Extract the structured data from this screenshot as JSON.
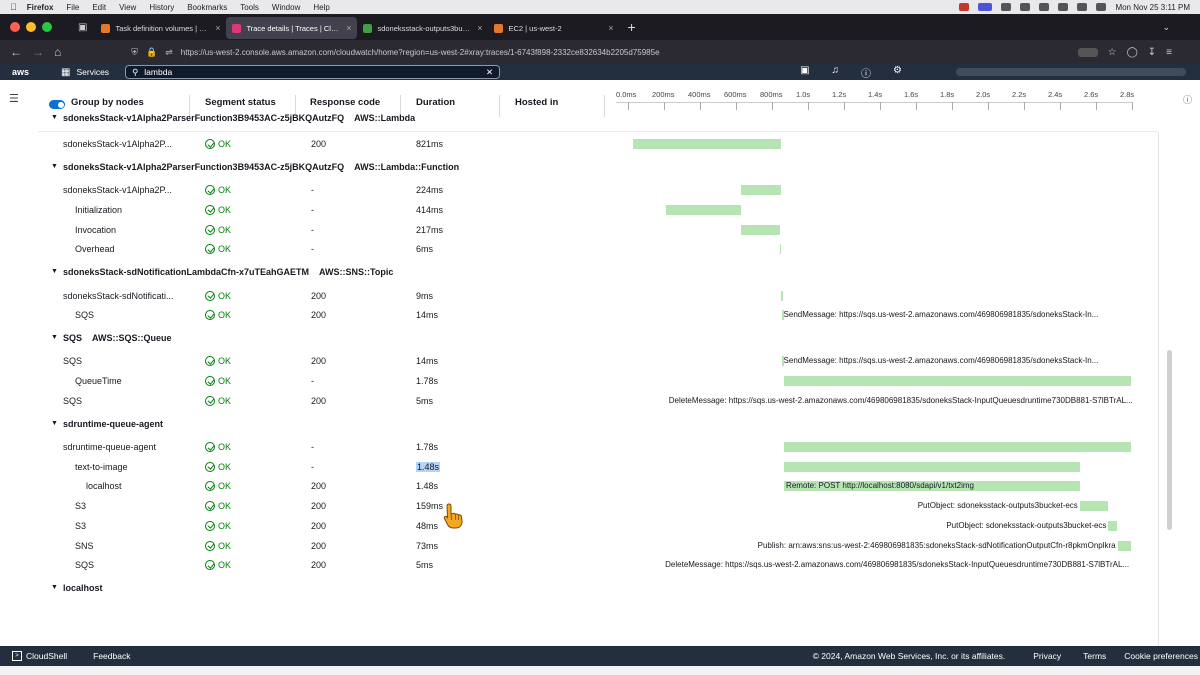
{
  "mac_menu": {
    "app": "Firefox",
    "items": [
      "File",
      "Edit",
      "View",
      "History",
      "Bookmarks",
      "Tools",
      "Window",
      "Help"
    ],
    "clock": "Mon Nov 25  3:11 PM"
  },
  "browser": {
    "tabs": [
      {
        "label": "Task definition volumes | Elastic",
        "color": "#e8772e"
      },
      {
        "label": "Trace details | Traces | CloudWa",
        "color": "#e0357a",
        "active": true
      },
      {
        "label": "sdoneksstack-outputs3bucket-",
        "color": "#3fa142"
      },
      {
        "label": "EC2 | us-west-2",
        "color": "#e8772e"
      }
    ],
    "url": "https://us-west-2.console.aws.amazon.com/cloudwatch/home?region=us-west-2#xray:traces/1-6743f898-2332ce832634b2205d75985e"
  },
  "aws_header": {
    "logo": "aws",
    "services_label": "Services",
    "search_value": "lambda"
  },
  "columns": {
    "group_by_nodes": "Group by nodes",
    "segment_status": "Segment status",
    "response_code": "Response code",
    "duration": "Duration",
    "hosted_in": "Hosted in"
  },
  "timeline_ticks": [
    "0.0ms",
    "200ms",
    "400ms",
    "600ms",
    "800ms",
    "1.0s",
    "1.2s",
    "1.4s",
    "1.6s",
    "1.8s",
    "2.0s",
    "2.2s",
    "2.4s",
    "2.6s",
    "2.8s"
  ],
  "rows": [
    {
      "kind": "group",
      "name": "sdoneksStack-v1Alpha2ParserFunction3B9453AC-z5jBKQAutzFQ",
      "type": "AWS::Lambda",
      "partial": true
    },
    {
      "kind": "row",
      "name": "sdoneksStack-v1Alpha2P...",
      "indent": 0,
      "status": "OK",
      "code": "200",
      "duration": "821ms",
      "bar_start_ms": 30,
      "bar_end_ms": 851,
      "label": ""
    },
    {
      "kind": "group",
      "name": "sdoneksStack-v1Alpha2ParserFunction3B9453AC-z5jBKQAutzFQ",
      "type": "AWS::Lambda::Function"
    },
    {
      "kind": "row",
      "name": "sdoneksStack-v1Alpha2P...",
      "indent": 0,
      "status": "OK",
      "code": "-",
      "duration": "224ms",
      "bar_start_ms": 627,
      "bar_end_ms": 851,
      "label": ""
    },
    {
      "kind": "row",
      "name": "Initialization",
      "indent": 1,
      "status": "OK",
      "code": "-",
      "duration": "414ms",
      "bar_start_ms": 213,
      "bar_end_ms": 627,
      "label": ""
    },
    {
      "kind": "row",
      "name": "Invocation",
      "indent": 1,
      "status": "OK",
      "code": "-",
      "duration": "217ms",
      "bar_start_ms": 627,
      "bar_end_ms": 844,
      "label": ""
    },
    {
      "kind": "row",
      "name": "Overhead",
      "indent": 1,
      "status": "OK",
      "code": "-",
      "duration": "6ms",
      "bar_start_ms": 844,
      "bar_end_ms": 850,
      "label": ""
    },
    {
      "kind": "group",
      "name": "sdoneksStack-sdNotificationLambdaCfn-x7uTEahGAETM",
      "type": "AWS::SNS::Topic"
    },
    {
      "kind": "row",
      "name": "sdoneksStack-sdNotificati...",
      "indent": 0,
      "status": "OK",
      "code": "200",
      "duration": "9ms",
      "bar_start_ms": 850,
      "bar_end_ms": 859,
      "label": ""
    },
    {
      "kind": "row",
      "name": "SQS",
      "indent": 1,
      "status": "OK",
      "code": "200",
      "duration": "14ms",
      "bar_start_ms": 853,
      "bar_end_ms": 867,
      "label": "SendMessage: https://sqs.us-west-2.amazonaws.com/469806981835/sdoneksStack-In...",
      "label_side": "right"
    },
    {
      "kind": "group",
      "name": "SQS",
      "type": "AWS::SQS::Queue"
    },
    {
      "kind": "row",
      "name": "SQS",
      "indent": 0,
      "status": "OK",
      "code": "200",
      "duration": "14ms",
      "bar_start_ms": 853,
      "bar_end_ms": 867,
      "label": "SendMessage: https://sqs.us-west-2.amazonaws.com/469806981835/sdoneksStack-In...",
      "label_side": "right"
    },
    {
      "kind": "row",
      "name": "QueueTime",
      "indent": 1,
      "status": "OK",
      "code": "-",
      "duration": "1.78s",
      "bar_start_ms": 867,
      "bar_end_ms": 2820,
      "label": ""
    },
    {
      "kind": "row",
      "name": "SQS",
      "indent": 0,
      "status": "OK",
      "code": "200",
      "duration": "5ms",
      "bar_start_ms": 2815,
      "bar_end_ms": 2820,
      "label": "DeleteMessage: https://sqs.us-west-2.amazonaws.com/469806981835/sdoneksStack-InputQueuesdruntime730DB881-S7lBTrAL...",
      "label_side": "left"
    },
    {
      "kind": "group",
      "name": "sdruntime-queue-agent",
      "type": ""
    },
    {
      "kind": "row",
      "name": "sdruntime-queue-agent",
      "indent": 0,
      "status": "OK",
      "code": "-",
      "duration": "1.78s",
      "bar_start_ms": 867,
      "bar_end_ms": 2820,
      "label": ""
    },
    {
      "kind": "row",
      "name": "text-to-image",
      "indent": 1,
      "status": "OK",
      "code": "-",
      "duration": "1.48s",
      "bar_start_ms": 867,
      "bar_end_ms": 2510,
      "label": "",
      "selected": true
    },
    {
      "kind": "row",
      "name": "localhost",
      "indent": 2,
      "status": "OK",
      "code": "200",
      "duration": "1.48s",
      "bar_start_ms": 867,
      "bar_end_ms": 2510,
      "label": "Remote: POST http://localhost:8080/sdapi/v1/txt2img",
      "label_side": "inside"
    },
    {
      "kind": "row",
      "name": "S3",
      "indent": 1,
      "status": "OK",
      "code": "200",
      "duration": "159ms",
      "bar_start_ms": 2510,
      "bar_end_ms": 2669,
      "label": "PutObject: sdoneksstack-outputs3bucket-ecs",
      "label_side": "left"
    },
    {
      "kind": "row",
      "name": "S3",
      "indent": 1,
      "status": "OK",
      "code": "200",
      "duration": "48ms",
      "bar_start_ms": 2669,
      "bar_end_ms": 2717,
      "label": "PutObject: sdoneksstack-outputs3bucket-ecs",
      "label_side": "left"
    },
    {
      "kind": "row",
      "name": "SNS",
      "indent": 1,
      "status": "OK",
      "code": "200",
      "duration": "73ms",
      "bar_start_ms": 2720,
      "bar_end_ms": 2793,
      "label": "Publish: arn:aws:sns:us-west-2:469806981835:sdoneksStack-sdNotificationOutputCfn-r8pkmOnplkra",
      "label_side": "left"
    },
    {
      "kind": "row",
      "name": "SQS",
      "indent": 1,
      "status": "OK",
      "code": "200",
      "duration": "5ms",
      "bar_start_ms": 2795,
      "bar_end_ms": 2800,
      "label": "DeleteMessage: https://sqs.us-west-2.amazonaws.com/469806981835/sdoneksStack-InputQueuesdruntime730DB881-S7lBTrAL...",
      "label_side": "left"
    },
    {
      "kind": "group",
      "name": "localhost",
      "type": ""
    }
  ],
  "footer": {
    "cloudshell": "CloudShell",
    "feedback": "Feedback",
    "copyright": "© 2024, Amazon Web Services, Inc. or its affiliates.",
    "privacy": "Privacy",
    "terms": "Terms",
    "cookies": "Cookie preferences"
  },
  "colors": {
    "aws_header": "#232f3e",
    "ok_green": "#037f0c",
    "bar_green": "#b7e4b3",
    "toggle_blue": "#0972d3"
  }
}
